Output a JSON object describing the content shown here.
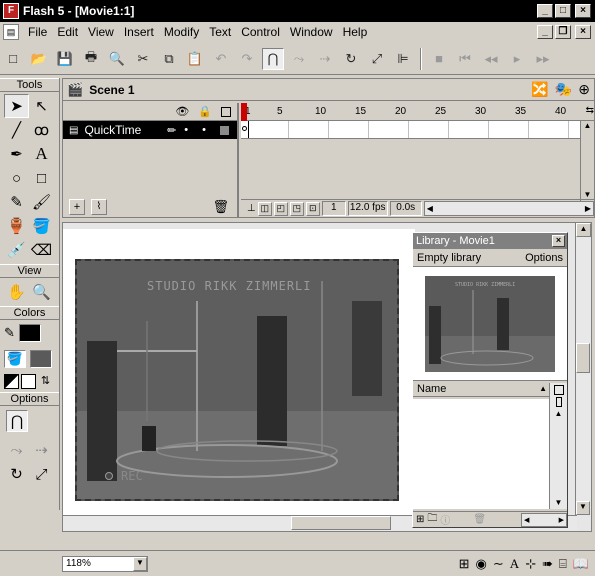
{
  "window": {
    "title": "Flash 5 - [Movie1:1]",
    "app_icon": "F",
    "minimize": "_",
    "maximize": "□",
    "close": "×"
  },
  "menu": {
    "items": [
      "File",
      "Edit",
      "View",
      "Insert",
      "Modify",
      "Text",
      "Control",
      "Window",
      "Help"
    ]
  },
  "toolbar": {
    "icons": [
      "new-icon",
      "open-icon",
      "save-icon",
      "print-icon",
      "print-preview-icon",
      "cut-icon",
      "copy-icon",
      "paste-icon",
      "undo-icon",
      "redo-icon",
      "snap-magnet-icon",
      "smooth-icon",
      "straighten-icon",
      "rotate-icon",
      "scale-icon",
      "align-icon",
      "stop-icon",
      "rewind-icon",
      "step-back-icon",
      "play-icon",
      "step-forward-icon"
    ]
  },
  "tools": {
    "title": "Tools",
    "view_title": "View",
    "colors_title": "Colors",
    "options_title": "Options",
    "stroke_color": "#000000",
    "fill_color": "#5a5a5a"
  },
  "scene": {
    "label": "Scene 1"
  },
  "timeline": {
    "layer_name": "QuickTime",
    "frame_numbers": [
      "1",
      "5",
      "10",
      "15",
      "20",
      "25",
      "30",
      "35",
      "40"
    ],
    "current_frame": "1",
    "frame_rate": "12.0 fps",
    "elapsed": "0.0s"
  },
  "stage": {
    "overlay_text": "STUDIO RIKK ZIMMERLI",
    "rec_text": "REC"
  },
  "library": {
    "title": "Library - Movie1",
    "menu_left": "Empty library",
    "menu_right": "Options",
    "column_name": "Name",
    "preview_overlay": "STUDIO RIKK ZIMMERLI"
  },
  "status": {
    "zoom": "118%"
  }
}
